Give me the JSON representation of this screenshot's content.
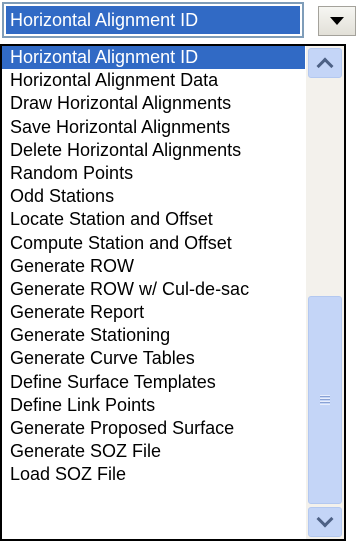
{
  "combo": {
    "selected_value": "Horizontal Alignment ID"
  },
  "dropdown": {
    "selected_index": 0,
    "items": [
      "Horizontal Alignment ID",
      "Horizontal Alignment Data",
      "Draw Horizontal Alignments",
      "Save Horizontal Alignments",
      "Delete Horizontal Alignments",
      "Random Points",
      "Odd Stations",
      "Locate Station and Offset",
      "Compute Station and Offset",
      "Generate ROW",
      "Generate ROW w/ Cul-de-sac",
      "Generate Report",
      "Generate Stationing",
      "Generate Curve Tables",
      "Define Surface Templates",
      "Define Link Points",
      "Generate Proposed Surface",
      "Generate SOZ File",
      "Load SOZ File"
    ]
  },
  "icons": {
    "combo_button": "chevron-down-icon",
    "scroll_up": "chevron-up-icon",
    "scroll_down": "chevron-down-icon",
    "thumb_grip": "grip-icon"
  },
  "colors": {
    "selection": "#316ac5",
    "scrollbar": "#c4d5f7"
  }
}
